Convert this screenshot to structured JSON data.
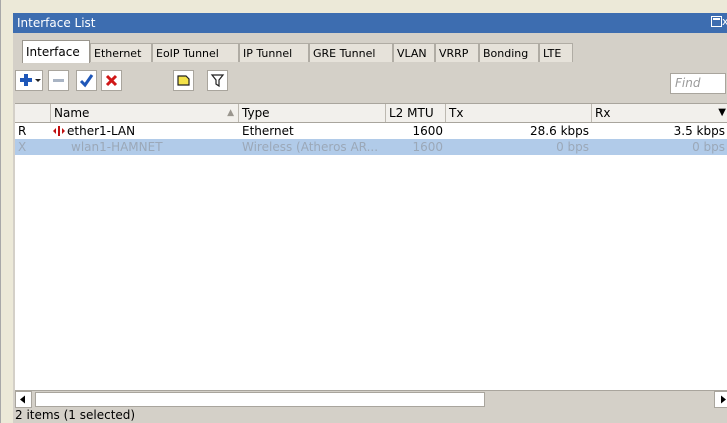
{
  "window": {
    "title": "Interface List",
    "close_glyph": "x"
  },
  "tabs": [
    {
      "label": "Interface",
      "active": true
    },
    {
      "label": "Ethernet"
    },
    {
      "label": "EoIP Tunnel"
    },
    {
      "label": "IP Tunnel"
    },
    {
      "label": "GRE Tunnel"
    },
    {
      "label": "VLAN"
    },
    {
      "label": "VRRP"
    },
    {
      "label": "Bonding"
    },
    {
      "label": "LTE"
    }
  ],
  "toolbar": {
    "find_placeholder": "Find",
    "buttons": [
      "add-icon",
      "remove-icon",
      "enable-icon",
      "disable-icon",
      "comment-icon",
      "filter-icon"
    ]
  },
  "table": {
    "columns": [
      {
        "label": ""
      },
      {
        "label": "Name"
      },
      {
        "label": "Type"
      },
      {
        "label": "L2 MTU"
      },
      {
        "label": "Tx"
      },
      {
        "label": "Rx"
      }
    ],
    "rows": [
      {
        "flag": "R",
        "name": "ether1-LAN",
        "type": "Ethernet",
        "l2mtu": "1600",
        "tx": "28.6 kbps",
        "rx": "3.5 kbps",
        "selected": false
      },
      {
        "flag": "X",
        "name": "wlan1-HAMNET",
        "type": "Wireless (Atheros AR...",
        "l2mtu": "1600",
        "tx": "0 bps",
        "rx": "0 bps",
        "selected": true
      }
    ]
  },
  "status": {
    "text": "2 items (1 selected)"
  },
  "colors": {
    "titlebar": "#3d6db0",
    "selection": "#b1cbe9",
    "chrome": "#d4d0c8"
  }
}
